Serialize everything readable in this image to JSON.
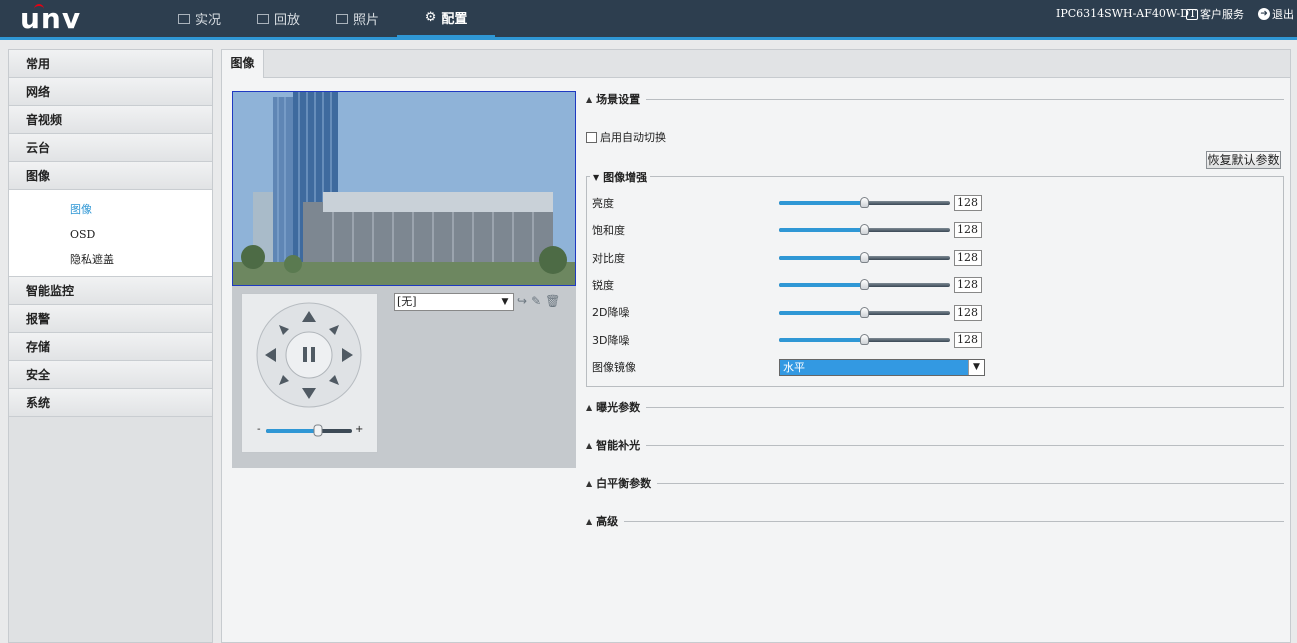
{
  "brand": {
    "logo": "unv"
  },
  "nav": [
    {
      "label": "实况",
      "icon": "monitor-icon"
    },
    {
      "label": "回放",
      "icon": "playback-icon"
    },
    {
      "label": "照片",
      "icon": "photo-icon"
    },
    {
      "label": "配置",
      "icon": "gear-icon",
      "active": true
    }
  ],
  "header": {
    "device": "IPC6314SWH-AF40W-DT",
    "service": "客户服务",
    "logout": "退出"
  },
  "sidebar": {
    "items": [
      {
        "label": "常用"
      },
      {
        "label": "网络"
      },
      {
        "label": "音视频"
      },
      {
        "label": "云台"
      },
      {
        "label": "图像"
      },
      {
        "label": "智能监控"
      },
      {
        "label": "报警"
      },
      {
        "label": "存储"
      },
      {
        "label": "安全"
      },
      {
        "label": "系统"
      }
    ],
    "subitems": [
      {
        "label": "图像",
        "active": true
      },
      {
        "label": "OSD"
      },
      {
        "label": "隐私遮盖"
      }
    ]
  },
  "tab": {
    "label": "图像"
  },
  "ptz": {
    "preset_value": "[无]",
    "zoom_minus": "-",
    "zoom_plus": "+"
  },
  "scene": {
    "title": "场景设置",
    "auto_switch": "启用自动切换",
    "auto_switch_checked": false
  },
  "restore_button": "恢复默认参数",
  "enhance": {
    "title": "图像增强",
    "rows": [
      {
        "label": "亮度",
        "value": "128"
      },
      {
        "label": "饱和度",
        "value": "128"
      },
      {
        "label": "对比度",
        "value": "128"
      },
      {
        "label": "锐度",
        "value": "128"
      },
      {
        "label": "2D降噪",
        "value": "128"
      },
      {
        "label": "3D降噪",
        "value": "128"
      }
    ],
    "mirror_label": "图像镜像",
    "mirror_value": "水平"
  },
  "sections": {
    "exposure": "曝光参数",
    "smart_light": "智能补光",
    "white_balance": "白平衡参数",
    "advanced": "高级"
  },
  "colors": {
    "header_bg": "#2d3e4f",
    "accent": "#2f97d5"
  }
}
